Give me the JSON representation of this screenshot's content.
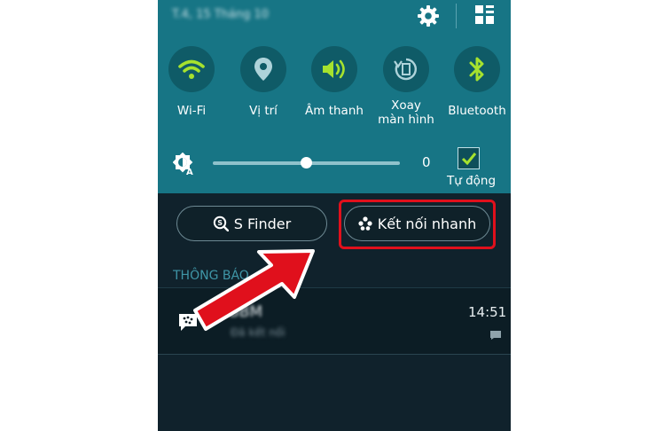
{
  "status_bar": {
    "date": "T.4, 15 Tháng 10"
  },
  "quick_toggles": [
    {
      "label": "Wi-Fi",
      "icon": "wifi-icon",
      "state": "on"
    },
    {
      "label": "Vị trí",
      "icon": "location-icon",
      "state": "off"
    },
    {
      "label": "Âm thanh",
      "icon": "sound-icon",
      "state": "on"
    },
    {
      "label_line1": "Xoay",
      "label_line2": "màn hình",
      "icon": "screen-rotation-icon",
      "state": "off"
    },
    {
      "label": "Bluetooth",
      "icon": "bluetooth-icon",
      "state": "on"
    }
  ],
  "brightness": {
    "value_text": "0",
    "level": 0.5,
    "auto_label": "Tự động",
    "auto_checked": true
  },
  "buttons": {
    "s_finder": "S Finder",
    "quick_connect": "Kết nối nhanh"
  },
  "notifications": {
    "header": "THÔNG BÁO",
    "items": [
      {
        "app": "BBM",
        "text": "Đã kết nối",
        "time": "14:51"
      }
    ]
  },
  "colors": {
    "panel": "#177585",
    "toggle_on": "#a6e22e",
    "toggle_off": "#aed3da",
    "background": "#10222c",
    "highlight": "#e0101c"
  }
}
